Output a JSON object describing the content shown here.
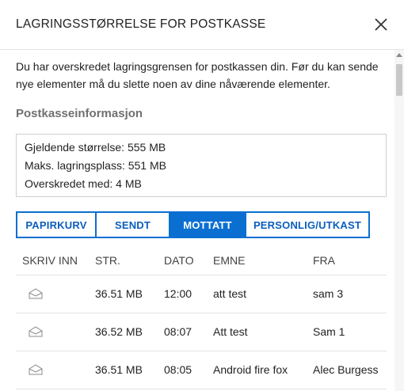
{
  "dialog": {
    "title": "LAGRINGSSTØRRELSE FOR POSTKASSE",
    "close_icon": "close-icon"
  },
  "message": "Du har overskredet lagringsgrensen for postkassen din. Før du kan sende nye elementer må du slette noen av dine nåværende elementer.",
  "mailbox_info": {
    "heading": "Postkasseinformasjon",
    "current_size": "Gjeldende størrelse: 555 MB",
    "max_storage": "Maks. lagringsplass: 551 MB",
    "exceeded_by": "Overskredet med: 4 MB"
  },
  "tabs": [
    {
      "label": "PAPIRKURV",
      "active": false
    },
    {
      "label": "SENDT",
      "active": false
    },
    {
      "label": "MOTTATT",
      "active": true
    },
    {
      "label": "PERSONLIG/UTKAST",
      "active": false
    }
  ],
  "table": {
    "columns": [
      "SKRIV INN",
      "STR.",
      "DATO",
      "EMNE",
      "FRA"
    ],
    "rows": [
      {
        "icon": "envelope-open-icon",
        "size": "36.51 MB",
        "date": "12:00",
        "subject": "att test",
        "from": "sam 3"
      },
      {
        "icon": "envelope-open-icon",
        "size": "36.52 MB",
        "date": "08:07",
        "subject": "Att test",
        "from": "Sam 1"
      },
      {
        "icon": "envelope-open-icon",
        "size": "36.51 MB",
        "date": "08:05",
        "subject": "Android fire fox",
        "from": "Alec Burgess"
      }
    ]
  },
  "colors": {
    "accent": "#0b6fd1",
    "section_heading": "#707070",
    "divider": "#e3e3e3"
  }
}
